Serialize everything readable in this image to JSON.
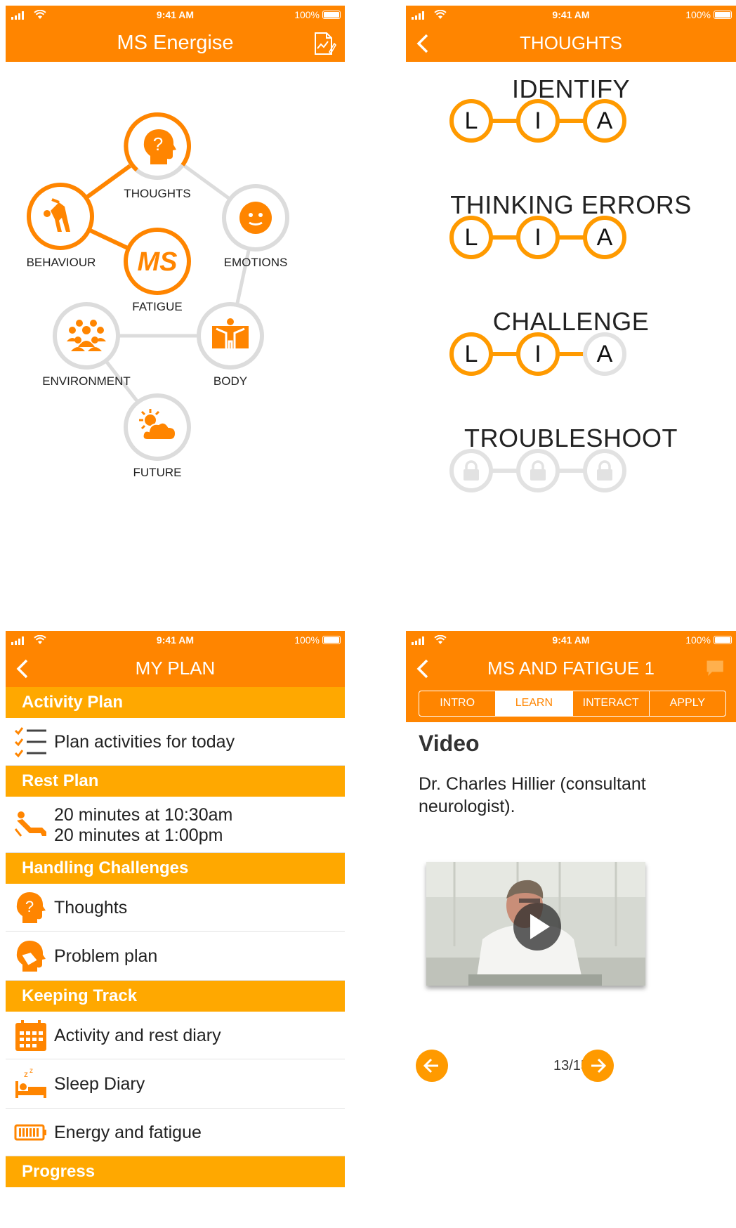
{
  "status": {
    "time": "9:41 AM",
    "battery": "100%"
  },
  "screen1": {
    "title": "MS Energise",
    "center": {
      "icon_text": "MS",
      "label": "FATIGUE"
    },
    "nodes": {
      "thoughts": "THOUGHTS",
      "behaviour": "BEHAVIOUR",
      "emotions": "EMOTIONS",
      "environment": "ENVIRONMENT",
      "body": "BODY",
      "future": "FUTURE"
    }
  },
  "screen2": {
    "title": "THOUGHTS",
    "steps": [
      {
        "title": "IDENTIFY",
        "letters": [
          "L",
          "I",
          "A"
        ]
      },
      {
        "title": "THINKING ERRORS",
        "letters": [
          "L",
          "I",
          "A"
        ]
      },
      {
        "title": "CHALLENGE",
        "letters": [
          "L",
          "I",
          "A"
        ]
      },
      {
        "title": "TROUBLESHOOT"
      }
    ]
  },
  "screen3": {
    "title": "MY PLAN",
    "sections": {
      "activity": "Activity Plan",
      "rest": "Rest Plan",
      "challenges": "Handling Challenges",
      "tracking": "Keeping Track",
      "progress": "Progress"
    },
    "items": {
      "plan_today": "Plan activities for today",
      "rest_1": "20 minutes at 10:30am",
      "rest_2": "20 minutes at 1:00pm",
      "thoughts": "Thoughts",
      "problem_plan": "Problem plan",
      "activity_diary": "Activity and rest diary",
      "sleep_diary": "Sleep Diary",
      "energy": "Energy and fatigue"
    }
  },
  "screen4": {
    "title": "MS AND FATIGUE 1",
    "tabs": [
      "INTRO",
      "LEARN",
      "INTERACT",
      "APPLY"
    ],
    "active_tab": "LEARN",
    "heading": "Video",
    "body": "Dr. Charles Hillier (consultant neurologist).",
    "page": "13/15"
  },
  "colors": {
    "primary": "#ff8500",
    "section": "#ffa800",
    "ring_active": "#ff9a00",
    "ring_inactive": "#e2e2e2"
  }
}
